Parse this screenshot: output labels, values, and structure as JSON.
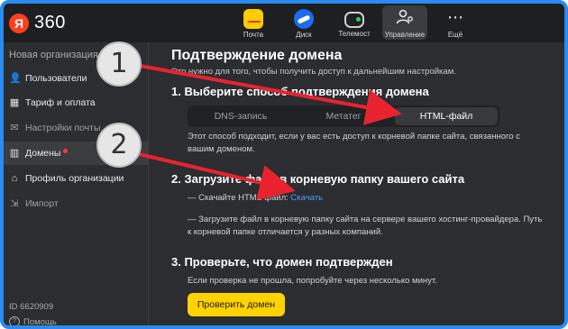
{
  "logo": {
    "mark": "Я",
    "text": "360"
  },
  "apps": [
    {
      "label": "Почта",
      "icon": "mail-icon"
    },
    {
      "label": "Диск",
      "icon": "disk-icon"
    },
    {
      "label": "Телемост",
      "icon": "telemost-icon"
    },
    {
      "label": "Управление",
      "icon": "admin-icon",
      "active": true
    },
    {
      "label": "Ещё",
      "icon": "more-icon"
    }
  ],
  "sidebar": {
    "org_label": "Новая организация",
    "items": [
      {
        "label": "Пользователи",
        "icon": "users-icon"
      },
      {
        "label": "Тариф и оплата",
        "icon": "tariff-icon"
      },
      {
        "label": "Настройки почты",
        "icon": "mail-settings-icon"
      },
      {
        "label": "Домены",
        "icon": "domains-icon",
        "active": true
      },
      {
        "label": "Профиль организации",
        "icon": "home-icon"
      },
      {
        "label": "Импорт",
        "icon": "import-icon"
      }
    ],
    "org_id": "ID 6620909",
    "help": "Помощь"
  },
  "main": {
    "title": "Подтверждение домена",
    "subtitle": "Это нужно для того, чтобы получить доступ к дальнейшим настройкам.",
    "step1": "1.  Выберите способ подтверждения домена",
    "methods": [
      "DNS-запись",
      "Метатег",
      "HTML-файл"
    ],
    "method_note": "Этот способ подходит, если у вас есть доступ к корневой папке сайта, связанного с вашим доменом.",
    "step2": "2.  Загрузите файл в корневую папку вашего сайта",
    "download_prefix": "— Скачайте HTML-файл: ",
    "download_link": "Скачать",
    "upload_note": "— Загрузите файл в корневую папку сайта на сервере вашего хостинг-провайдера. Путь к корневой папке отличается у разных компаний.",
    "step3": "3.  Проверьте, что домен подтвержден",
    "retry_note": "Если проверка не прошла, попробуйте через несколько минут.",
    "verify_button": "Проверить домен"
  },
  "annotations": {
    "badge1": "1",
    "badge2": "2",
    "color": "#e8232f"
  }
}
